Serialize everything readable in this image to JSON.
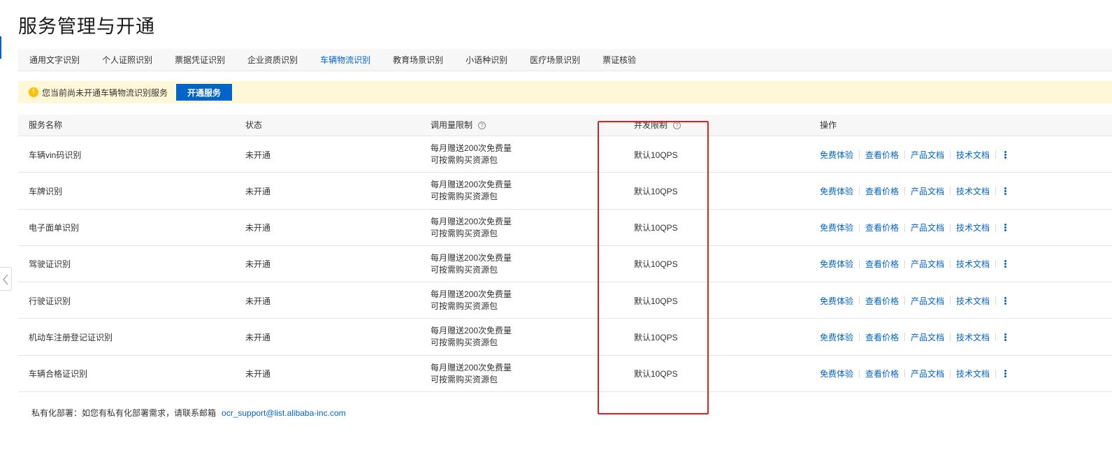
{
  "page": {
    "title": "服务管理与开通"
  },
  "tabs": [
    {
      "label": "通用文字识别"
    },
    {
      "label": "个人证照识别"
    },
    {
      "label": "票据凭证识别"
    },
    {
      "label": "企业资质识别"
    },
    {
      "label": "车辆物流识别",
      "active": true
    },
    {
      "label": "教育场景识别"
    },
    {
      "label": "小语种识别"
    },
    {
      "label": "医疗场景识别"
    },
    {
      "label": "票证核验"
    }
  ],
  "notice": {
    "icon": "warning-icon",
    "text": "您当前尚未开通车辆物流识别服务",
    "button_label": "开通服务"
  },
  "table": {
    "headers": {
      "name": "服务名称",
      "status": "状态",
      "quota": "调用量限制",
      "concurrency": "并发限制",
      "ops": "操作"
    },
    "help_icon_glyph": "?",
    "rows": [
      {
        "name": "车辆vin码识别",
        "status": "未开通",
        "quota_line1": "每月赠送200次免费量",
        "quota_line2": "可按需购买资源包",
        "concurrency": "默认10QPS"
      },
      {
        "name": "车牌识别",
        "status": "未开通",
        "quota_line1": "每月赠送200次免费量",
        "quota_line2": "可按需购买资源包",
        "concurrency": "默认10QPS"
      },
      {
        "name": "电子面单识别",
        "status": "未开通",
        "quota_line1": "每月赠送200次免费量",
        "quota_line2": "可按需购买资源包",
        "concurrency": "默认10QPS"
      },
      {
        "name": "驾驶证识别",
        "status": "未开通",
        "quota_line1": "每月赠送200次免费量",
        "quota_line2": "可按需购买资源包",
        "concurrency": "默认10QPS"
      },
      {
        "name": "行驶证识别",
        "status": "未开通",
        "quota_line1": "每月赠送200次免费量",
        "quota_line2": "可按需购买资源包",
        "concurrency": "默认10QPS"
      },
      {
        "name": "机动车注册登记证识别",
        "status": "未开通",
        "quota_line1": "每月赠送200次免费量",
        "quota_line2": "可按需购买资源包",
        "concurrency": "默认10QPS"
      },
      {
        "name": "车辆合格证识别",
        "status": "未开通",
        "quota_line1": "每月赠送200次免费量",
        "quota_line2": "可按需购买资源包",
        "concurrency": "默认10QPS"
      }
    ],
    "ops_labels": {
      "trial": "免费体验",
      "price": "查看价格",
      "product_doc": "产品文档",
      "tech_doc": "技术文档"
    }
  },
  "footer": {
    "text": "私有化部署：如您有私有化部署需求，请联系邮箱",
    "email": "ocr_support@list.alibaba-inc.com"
  },
  "colors": {
    "accent": "#0064c8",
    "notice_bg": "#fff8d8",
    "warning": "#ffc000",
    "highlight": "#e02020"
  }
}
